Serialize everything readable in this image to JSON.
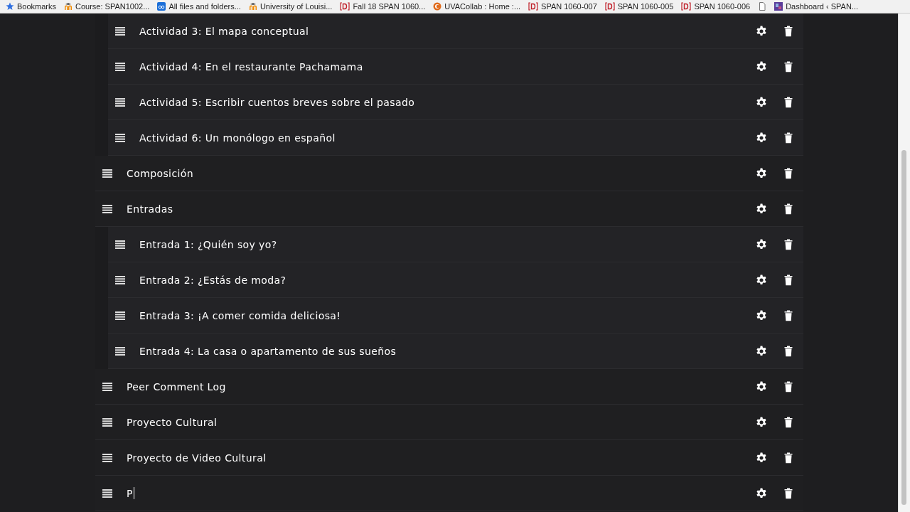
{
  "bookmarks": [
    {
      "label": "Bookmarks",
      "kind": "star"
    },
    {
      "label": "Course: SPAN1002...",
      "kind": "moodle"
    },
    {
      "label": "All files and folders...",
      "kind": "box"
    },
    {
      "label": "University of Louisi...",
      "kind": "moodle"
    },
    {
      "label": "Fall 18 SPAN 1060...",
      "kind": "d"
    },
    {
      "label": "UVACollab : Home :...",
      "kind": "collab"
    },
    {
      "label": "SPAN 1060-007",
      "kind": "d"
    },
    {
      "label": "SPAN 1060-005",
      "kind": "d"
    },
    {
      "label": "SPAN 1060-006",
      "kind": "d"
    },
    {
      "kind": "file"
    },
    {
      "label": "Dashboard ‹ SPAN...",
      "kind": "dashboard"
    }
  ],
  "items": [
    {
      "children": [
        {
          "label": "Actividad 3: El mapa conceptual"
        },
        {
          "label": "Actividad 4: En el restaurante Pachamama"
        },
        {
          "label": "Actividad 5: Escribir cuentos breves sobre el pasado"
        },
        {
          "label": "Actividad 6: Un monólogo en español"
        }
      ]
    },
    {
      "label": "Composición"
    },
    {
      "label": "Entradas",
      "children": [
        {
          "label": "Entrada 1: ¿Quién soy yo?"
        },
        {
          "label": "Entrada 2: ¿Estás de moda?"
        },
        {
          "label": "Entrada 3: ¡A comer comida deliciosa!"
        },
        {
          "label": "Entrada 4: La casa o apartamento de sus sueños"
        }
      ]
    },
    {
      "label": "Peer Comment Log"
    },
    {
      "label": "Proyecto Cultural"
    },
    {
      "label": "Proyecto de Video Cultural"
    },
    {
      "value": "P",
      "editing": true
    }
  ]
}
